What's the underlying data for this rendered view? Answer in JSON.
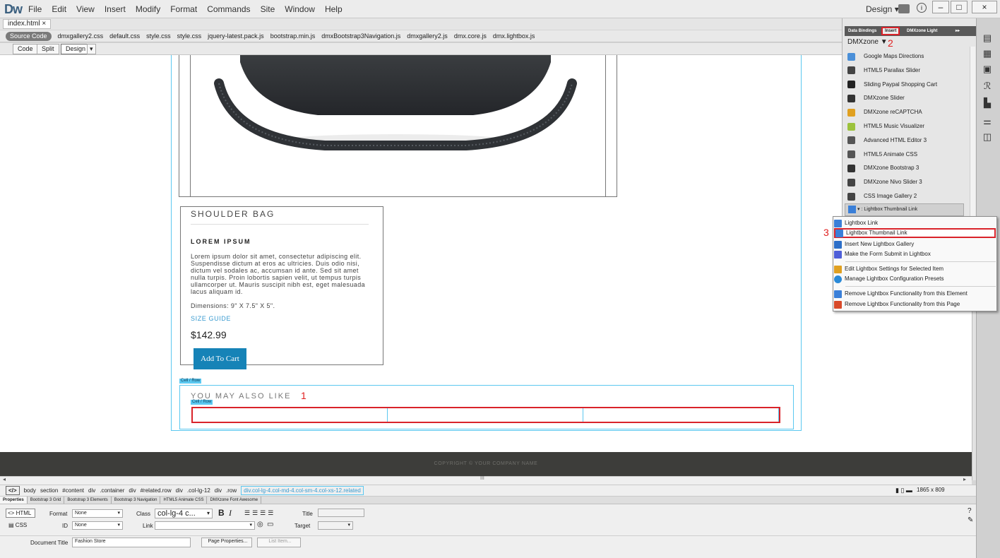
{
  "app": {
    "logo": "Dw",
    "menus": [
      "File",
      "Edit",
      "View",
      "Insert",
      "Modify",
      "Format",
      "Commands",
      "Site",
      "Window",
      "Help"
    ],
    "workspace": "Design",
    "window_buttons": [
      "–",
      "□",
      "×"
    ]
  },
  "document": {
    "tab": "index.html",
    "tab_close": "×",
    "source_code": "Source Code",
    "related_files": [
      "dmxgallery2.css",
      "default.css",
      "style.css",
      "style.css",
      "jquery-latest.pack.js",
      "bootstrap.min.js",
      "dmxBootstrap3Navigation.js",
      "dmxgallery2.js",
      "dmx.core.js",
      "dmx.lightbox.js"
    ],
    "views": [
      "Code",
      "Split",
      "Design"
    ]
  },
  "page": {
    "product_title": "SHOULDER BAG",
    "lorem_heading": "LOREM IPSUM",
    "lorem_text": "Lorem ipsum dolor sit amet, consectetur adipiscing elit. Suspendisse dictum at eros ac ultricies. Duis odio nisi, dictum vel sodales ac, accumsan id ante. Sed sit amet nulla turpis. Proin lobortis sapien velit, ut tempus turpis ullamcorper ut. Mauris suscipit nibh est, eget malesuada lacus aliquam id.",
    "dimensions": "Dimensions: 9\" X 7.5\" X 5\".",
    "size_guide": "SIZE GUIDE",
    "price": "$142.99",
    "add_to_cart": "Add To Cart",
    "cell_row_label": "Cell / Row",
    "you_may_also_like": "YOU MAY ALSO LIKE",
    "footer": "COPYRIGHT © YOUR COMPANY NAME"
  },
  "annotations": {
    "one": "1",
    "two": "2",
    "three": "3"
  },
  "tag_selector": {
    "code_icon": "</>",
    "tags": [
      "body",
      "section",
      "#content",
      "div",
      ".container",
      "div",
      "#related.row",
      "div",
      ".col-lg-12",
      "div",
      ".row"
    ],
    "current": "div.col-lg-4.col-md-4.col-sm-4.col-xs-12.related",
    "window_size": "1865 x 809"
  },
  "properties": {
    "tabs": [
      "Properties",
      "Bootstrap 3 Grid",
      "Bootstrap 3 Elements",
      "Bootstrap 3 Navigation",
      "HTML5 Animate CSS",
      "DMXzone Font Awesome"
    ],
    "html_btn": "HTML",
    "css_btn": "CSS",
    "format_label": "Format",
    "format_value": "None",
    "id_label": "ID",
    "id_value": "None",
    "class_label": "Class",
    "class_value": "col-lg-4 c...",
    "link_label": "Link",
    "title_label": "Title",
    "target_label": "Target",
    "doc_title_label": "Document Title",
    "doc_title_value": "Fashion Store",
    "page_properties": "Page Properties...",
    "list_item": "List Item..."
  },
  "insert_panel": {
    "tabs": [
      "Data Bindings",
      "Insert",
      "DMXzone Light"
    ],
    "category": "DMXzone",
    "items": [
      {
        "label": "Google Maps Directions",
        "icon": "map-pin-icon",
        "color": "#4a8fd8"
      },
      {
        "label": "HTML5 Parallax Slider",
        "icon": "parallax-icon",
        "color": "#444444"
      },
      {
        "label": "Sliding Paypal Shopping Cart",
        "icon": "cart-icon",
        "color": "#222222"
      },
      {
        "label": "DMXzone Slider",
        "icon": "slider-icon",
        "color": "#333333"
      },
      {
        "label": "DMXzone reCAPTCHA",
        "icon": "recaptcha-icon",
        "color": "#e0a020"
      },
      {
        "label": "HTML5 Music Visualizer",
        "icon": "visualizer-icon",
        "color": "#9cc23c"
      },
      {
        "label": "Advanced HTML Editor 3",
        "icon": "editor-icon",
        "color": "#555555"
      },
      {
        "label": "HTML5 Animate CSS",
        "icon": "animate-icon",
        "color": "#555555"
      },
      {
        "label": "DMXzone Bootstrap 3",
        "icon": "bootstrap-icon",
        "color": "#333333"
      },
      {
        "label": "DMXzone Nivo Slider 3",
        "icon": "nivo-icon",
        "color": "#444444"
      },
      {
        "label": "CSS Image Gallery 2",
        "icon": "gallery-icon",
        "color": "#444444"
      }
    ],
    "selected_item": ": Lightbox Thumbnail Link"
  },
  "lightbox_menu": {
    "items": [
      "Lightbox Link",
      "Lightbox Thumbnail Link",
      "Insert New Lightbox Gallery",
      "Make the Form Submit in Lightbox",
      "Edit Lightbox Settings for Selected Item",
      "Manage Lightbox Configuration Presets",
      "Remove Lightbox Functionality from this Element",
      "Remove Lightbox Functionality from this Page"
    ]
  },
  "colors": {
    "accent_red": "#d9232a",
    "guide_blue": "#5bc8f0",
    "button_blue": "#1683b7"
  }
}
